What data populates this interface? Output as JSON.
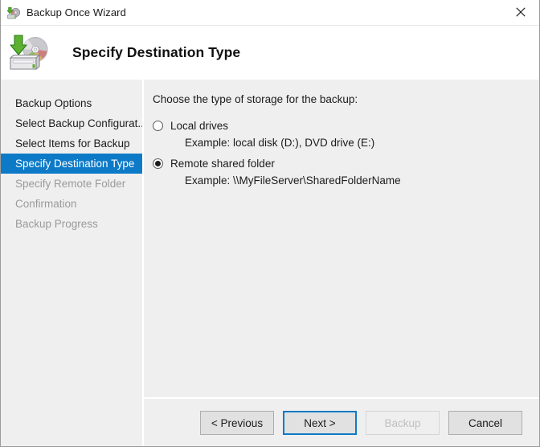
{
  "window": {
    "titlebar": {
      "icon": "backup-wizard-icon",
      "title": "Backup Once Wizard",
      "close_label": "close-icon"
    },
    "header": {
      "icon": "backup-disk-icon",
      "title": "Specify Destination Type"
    }
  },
  "sidebar": {
    "items": [
      {
        "label": "Backup Options",
        "state": "normal"
      },
      {
        "label": "Select Backup Configurat...",
        "state": "normal"
      },
      {
        "label": "Select Items for Backup",
        "state": "normal"
      },
      {
        "label": "Specify Destination Type",
        "state": "selected"
      },
      {
        "label": "Specify Remote Folder",
        "state": "disabled"
      },
      {
        "label": "Confirmation",
        "state": "disabled"
      },
      {
        "label": "Backup Progress",
        "state": "disabled"
      }
    ]
  },
  "main": {
    "prompt": "Choose the type of storage for the backup:",
    "options": [
      {
        "label": "Local drives",
        "example": "Example: local disk (D:), DVD drive (E:)",
        "selected": false
      },
      {
        "label": "Remote shared folder",
        "example": "Example: \\\\MyFileServer\\SharedFolderName",
        "selected": true
      }
    ]
  },
  "footer": {
    "buttons": [
      {
        "label": "< Previous",
        "state": "normal"
      },
      {
        "label": "Next >",
        "state": "focused"
      },
      {
        "label": "Backup",
        "state": "disabled"
      },
      {
        "label": "Cancel",
        "state": "normal"
      }
    ]
  },
  "colors": {
    "accent": "#0d7ac7",
    "panel": "#efefef",
    "button_face": "#e1e1e1",
    "text": "#1b1b1b",
    "text_disabled": "#9a9a9a"
  }
}
